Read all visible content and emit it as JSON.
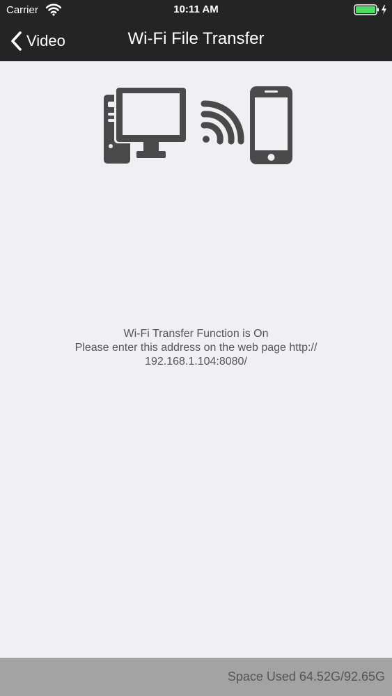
{
  "status_bar": {
    "carrier": "Carrier",
    "time": "10:11 AM",
    "battery_color": "#4cd964"
  },
  "nav": {
    "back_label": "Video",
    "title": "Wi-Fi File Transfer"
  },
  "illustration": {
    "icons": [
      "desktop-computer-icon",
      "wifi-signal-icon",
      "smartphone-icon"
    ],
    "icon_color": "#4a4a4a"
  },
  "message": {
    "line1": "Wi-Fi Transfer Function is On",
    "line2": "Please enter this address on the web page  http://",
    "line3": "192.168.1.104:8080/"
  },
  "footer": {
    "space_label": "Space Used",
    "space_value": "64.52G/92.65G"
  },
  "colors": {
    "header_bg": "#242424",
    "content_bg": "#efeff4",
    "footer_bg": "#a3a3a3",
    "text_gray": "#555555"
  }
}
